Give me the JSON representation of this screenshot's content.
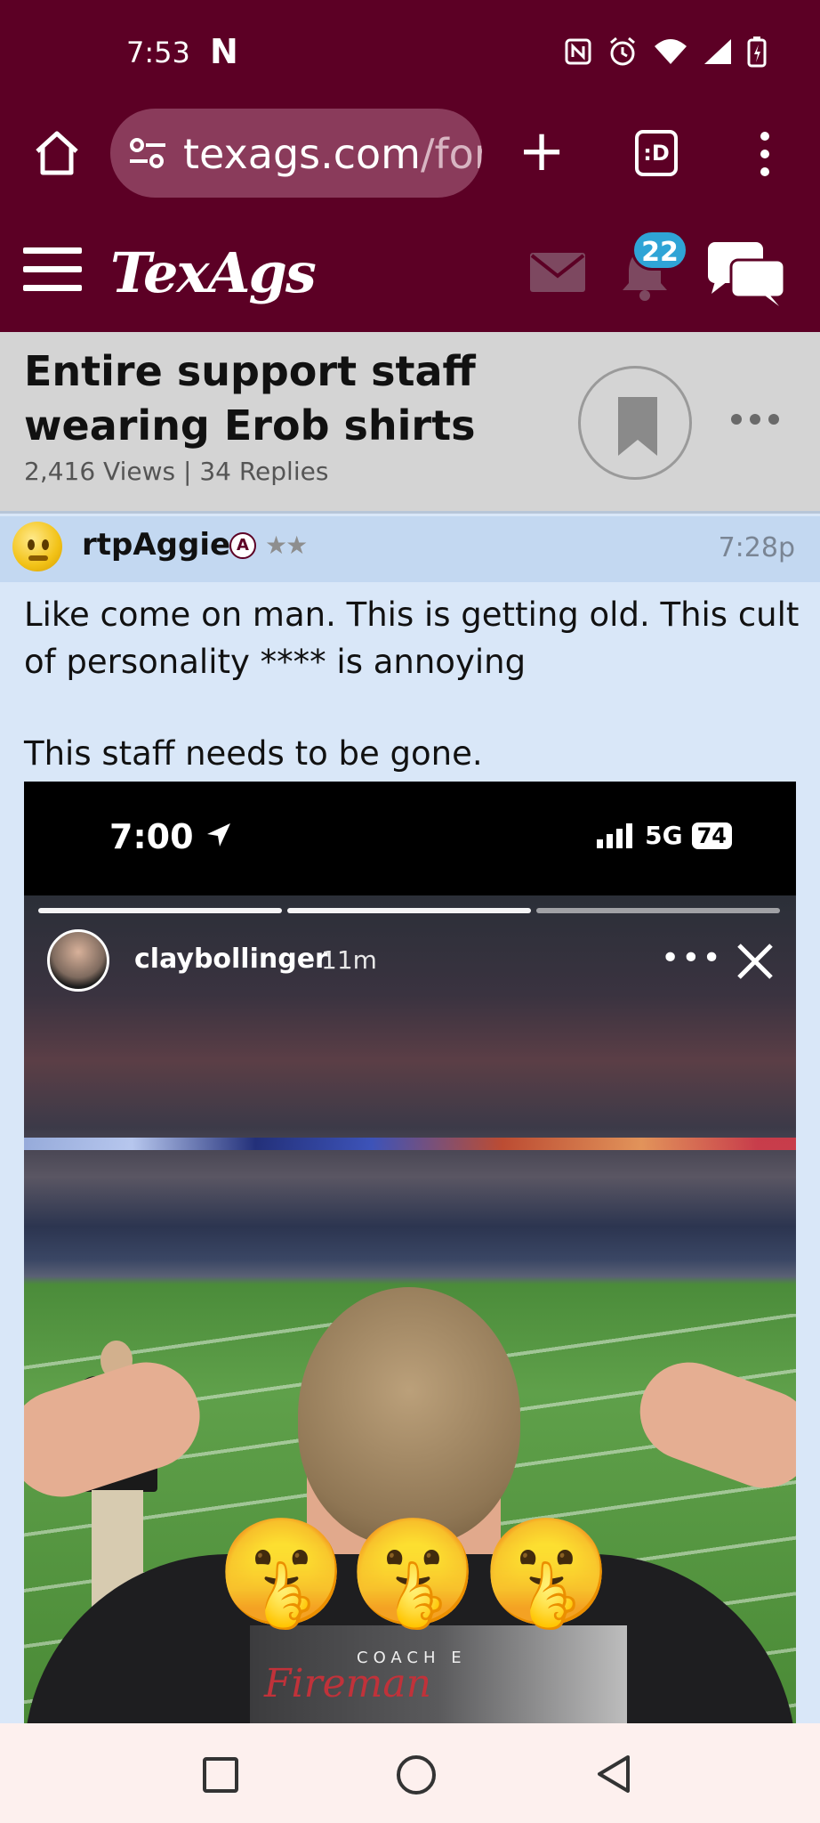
{
  "status_bar": {
    "time": "7:53",
    "n_icon": "N"
  },
  "browser": {
    "url_host": "texags.com",
    "url_path": "/for",
    "tabs_icon_label": ":D"
  },
  "site_nav": {
    "logo": "TexAgs",
    "notification_count": "22"
  },
  "thread": {
    "title": "Entire support staff wearing Erob shirts",
    "stats": "2,416 Views | 34 Replies"
  },
  "post": {
    "username": "rtpAggie",
    "rank_badge": "A",
    "stars": "★★",
    "time": "7:28p",
    "body_line1": "Like come on man. This is getting old. This cult of personality **** is annoying",
    "body_line2": "This staff needs to be gone."
  },
  "embed": {
    "time": "7:00",
    "network": "5G",
    "battery": "74",
    "story_user": "claybollinger",
    "story_age": "11m",
    "shirt_coach_text": "COACH E",
    "shirt_script_text": "Fireman",
    "emojis": [
      "🤫",
      "🤫",
      "🤫"
    ]
  },
  "colors": {
    "brand_maroon": "#5c0025",
    "post_bg": "#d9e7f8",
    "post_header_bg": "#c3d8f1",
    "badge_blue": "#2fa4d6"
  }
}
